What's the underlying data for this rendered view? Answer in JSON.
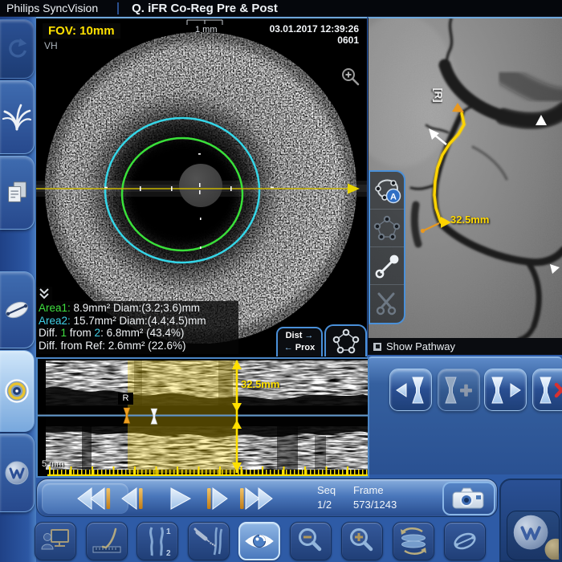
{
  "window": {
    "app_name": "Philips SyncVision",
    "study_title": "Q. iFR Co-Reg Pre & Post"
  },
  "sidebar": {
    "items": [
      {
        "name": "history",
        "state": "disabled"
      },
      {
        "name": "vessel-tree",
        "state": "normal"
      },
      {
        "name": "reports",
        "state": "normal"
      },
      {
        "name": "disc-measure",
        "state": "normal"
      },
      {
        "name": "ivus-view",
        "state": "active"
      },
      {
        "name": "waveform",
        "state": "normal"
      }
    ]
  },
  "ivus_view": {
    "fov_label": "FOV: 10mm",
    "vh_label": "VH",
    "scale_label": "1 mm",
    "datetime": "03.01.2017 12:39:26",
    "series_number": "0601",
    "measurements": {
      "area1_label": "Area1:",
      "area1_value": " 8.9mm² Diam:(3.2;3.6)mm",
      "area2_label": "Area2:",
      "area2_value": " 15.7mm² Diam:(4.4;4.5)mm",
      "diff_prefix": "Diff. ",
      "diff_n1": "1",
      "diff_mid": " from ",
      "diff_n2": "2",
      "diff_value": ": 6.8mm²  (43.4%)",
      "diff_ref_label": "Diff. from Ref:",
      "diff_ref_value": " 2.6mm²  (22.6%)"
    },
    "dist_prox_button": {
      "dist": "Dist",
      "prox": "Prox",
      "dist_arrow": "→",
      "prox_arrow": "←"
    }
  },
  "angio_view": {
    "ref_marker": "[R]",
    "distance_label": "32.5mm",
    "auto_tool_badge": "A",
    "show_pathway_label": "Show Pathway"
  },
  "longitudinal_view": {
    "ref_marker": "R",
    "distance_label": "32.5mm",
    "scale_label": "5 mm"
  },
  "playback": {
    "seq_label": "Seq",
    "seq_value": "1/2",
    "frame_label": "Frame",
    "frame_value": "573/1243"
  },
  "compare_tool": {
    "n1": "1",
    "n2": "2"
  },
  "colors": {
    "accent_yellow": "#ffd800",
    "contour_green": "#3fe03f",
    "contour_cyan": "#35d6e8",
    "marker_orange": "#f0a020",
    "panel_blue": "#2e5ba6",
    "border_lightblue": "#6fa8dc"
  },
  "icons": {
    "sidebar": [
      "history-icon",
      "vessel-tree-icon",
      "report-pages-icon",
      "disc-measure-icon",
      "ivus-target-icon",
      "waveform-sphere-icon"
    ],
    "angio_tools": [
      "auto-contour-icon",
      "contour-points-icon",
      "distance-line-icon",
      "scissors-icon"
    ],
    "transport": [
      "skip-start-icon",
      "step-back-icon",
      "play-icon",
      "step-forward-icon",
      "skip-end-icon"
    ],
    "bookmarks": [
      "prev-bookmark-icon",
      "add-bookmark-icon",
      "next-bookmark-icon",
      "delete-bookmark-icon"
    ],
    "bottom_toolbar": [
      "reviewer-icon",
      "pullback-ruler-icon",
      "compare-vessels-icon",
      "injection-icon",
      "eye-icon",
      "zoom-out-icon",
      "zoom-in-icon",
      "flip-views-icon",
      "disc-measure-icon"
    ],
    "misc": [
      "camera-icon",
      "magnifier-plus-icon",
      "collapse-chevron-icon",
      "show-pathway-checkbox"
    ]
  }
}
